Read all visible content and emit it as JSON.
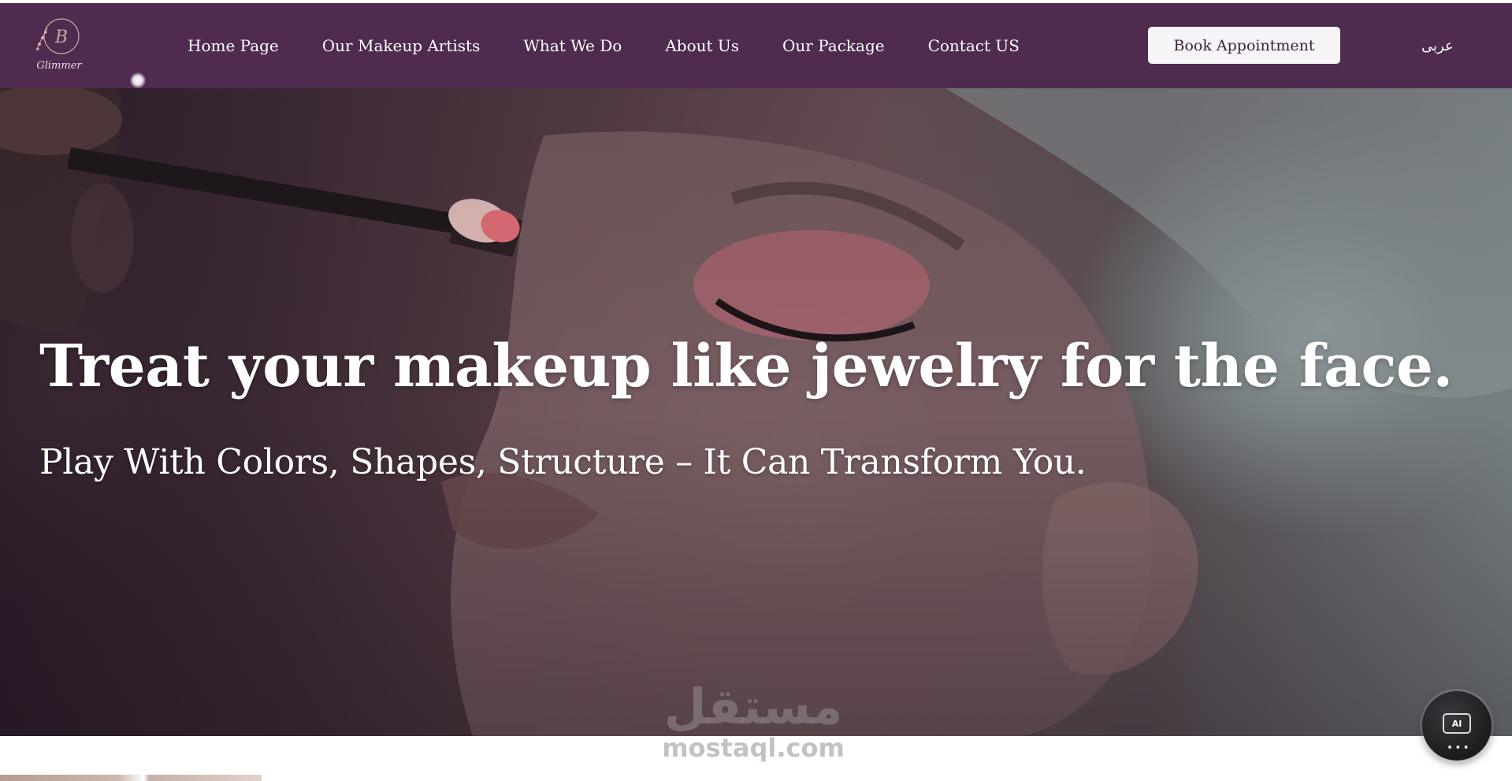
{
  "brand": {
    "logo_text": "Glimmer"
  },
  "nav": {
    "items": [
      {
        "label": "Home Page"
      },
      {
        "label": "Our Makeup Artists"
      },
      {
        "label": "What We Do"
      },
      {
        "label": "About Us"
      },
      {
        "label": "Our Package"
      },
      {
        "label": "Contact US"
      }
    ],
    "cta_label": "Book Appointment",
    "language_label": "عربى"
  },
  "hero": {
    "title": "Treat your makeup like jewelry for the face.",
    "subtitle": "Play With Colors, Shapes, Structure – It Can Transform You."
  },
  "watermark": {
    "arabic": "مستقل",
    "latin": "mostaql.com"
  },
  "ai_button": {
    "label": "AI",
    "dots": "•••"
  },
  "colors": {
    "navbar_bg": "#4e2b4f",
    "button_bg": "#f6f4f6",
    "button_text": "#3e2340",
    "text": "#ffffff"
  }
}
